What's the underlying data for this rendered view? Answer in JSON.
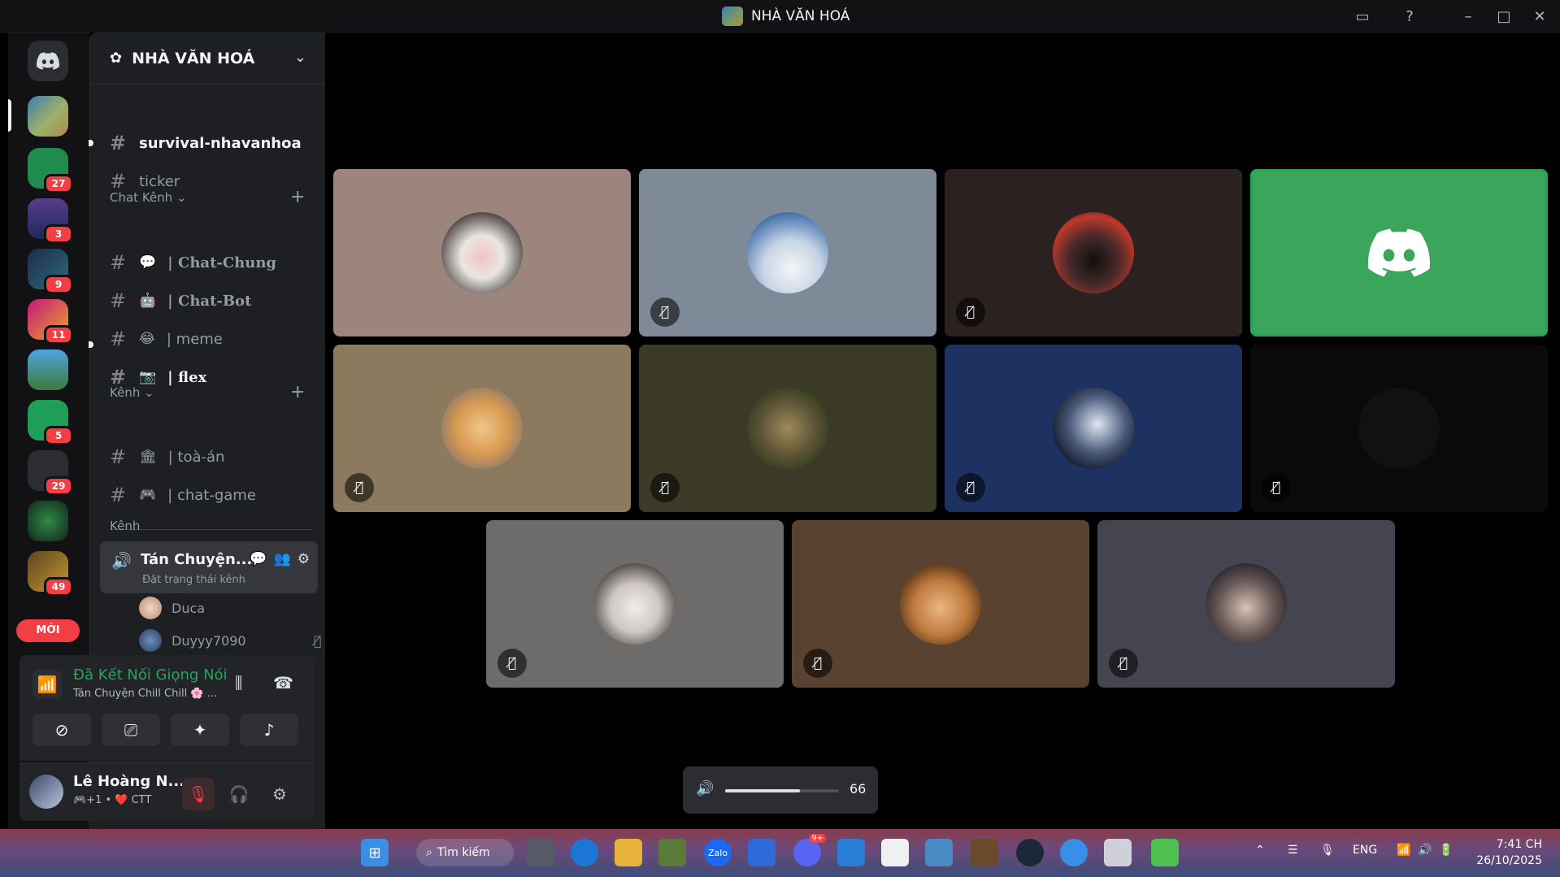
{
  "window": {
    "title": "NHÀ VĂN HOÁ"
  },
  "rail": {
    "badges": [
      "27",
      "3",
      "9",
      "11",
      "5",
      "29",
      "49"
    ],
    "new_label": "MỚI"
  },
  "server": {
    "name": "NHÀ VĂN HOÁ"
  },
  "channels_top": [
    {
      "name": "survival-nhavanhoa"
    },
    {
      "name": "ticker"
    }
  ],
  "categories": {
    "chat": "Chat Kênh",
    "kenh1": "Kênh",
    "kenh2": "Kênh"
  },
  "chat_channels": [
    {
      "emoji": "💬",
      "name": "| Chat-Chung"
    },
    {
      "emoji": "🤖",
      "name": "| Chat-Bot"
    },
    {
      "emoji": "😂",
      "name": "| meme"
    },
    {
      "emoji": "📷",
      "name": "| flex"
    }
  ],
  "kenh_channels": [
    {
      "emoji": "🏛",
      "name": "| toà-án"
    },
    {
      "emoji": "🎮",
      "name": "| chat-game"
    }
  ],
  "voice_channel": {
    "name": "Tán Chuyện...",
    "subtitle": "Đặt trạng thái kênh",
    "users": [
      "Duca",
      "Duyyy7090"
    ]
  },
  "voice_panel": {
    "status": "Đã Kết Nối Giọng Nói",
    "channel": "Tán Chuyện Chill Chill 🌸 ..."
  },
  "user": {
    "name": "Lê Hoàng N...",
    "status": "🎮+1 • ❤️ CTT"
  },
  "volume": {
    "value": "66",
    "level": 0.66
  },
  "taskbar": {
    "search_label": "Tìm kiếm",
    "discord_badge": "9+",
    "language": "ENG",
    "time": "7:41 CH",
    "date": "26/10/2025"
  },
  "colors": {
    "accent_green": "#23a55a",
    "badge_red": "#f23f43",
    "tile_speaking": "#3ba55c"
  }
}
